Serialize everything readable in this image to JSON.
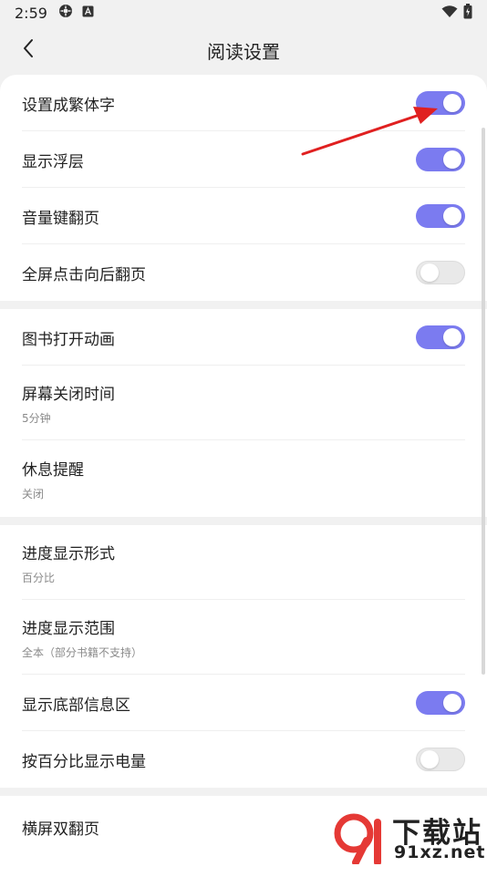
{
  "status_bar": {
    "time": "2:59",
    "icons": [
      "settings-app-icon",
      "notification-a-icon",
      "wifi-icon",
      "battery-icon"
    ]
  },
  "app_bar": {
    "title": "阅读设置",
    "back_icon": "back-arrow-icon"
  },
  "sections": [
    {
      "items": [
        {
          "label": "设置成繁体字",
          "type": "toggle",
          "on": true
        },
        {
          "label": "显示浮层",
          "type": "toggle",
          "on": true
        },
        {
          "label": "音量键翻页",
          "type": "toggle",
          "on": true
        },
        {
          "label": "全屏点击向后翻页",
          "type": "toggle",
          "on": false
        }
      ]
    },
    {
      "items": [
        {
          "label": "图书打开动画",
          "type": "toggle",
          "on": true
        },
        {
          "label": "屏幕关闭时间",
          "sub": "5分钟",
          "type": "value"
        },
        {
          "label": "休息提醒",
          "sub": "关闭",
          "type": "value"
        }
      ]
    },
    {
      "items": [
        {
          "label": "进度显示形式",
          "sub": "百分比",
          "type": "value"
        },
        {
          "label": "进度显示范围",
          "sub": "全本（部分书籍不支持）",
          "type": "value"
        },
        {
          "label": "显示底部信息区",
          "type": "toggle",
          "on": true
        },
        {
          "label": "按百分比显示电量",
          "type": "toggle",
          "on": false
        }
      ]
    },
    {
      "items": [
        {
          "label": "横屏双翻页",
          "type": "toggle",
          "on": false
        }
      ]
    }
  ],
  "colors": {
    "toggle_on": "#7b7bf0",
    "toggle_off": "#e9e9e9",
    "annotation_arrow": "#e02020",
    "watermark_logo": "#e53935"
  },
  "watermark": {
    "logo_glyph": "91",
    "top": "下载站",
    "bottom": "91xz.net"
  }
}
